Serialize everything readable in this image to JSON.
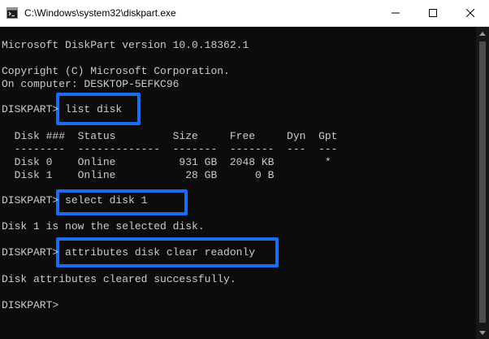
{
  "window": {
    "title": "C:\\Windows\\system32\\diskpart.exe",
    "icon": "console-icon",
    "controls": [
      "minimize-icon",
      "maximize-icon",
      "close-icon"
    ]
  },
  "colors": {
    "console_bg": "#0c0c0c",
    "console_text": "#cccccc",
    "highlight_box": "#1a6cf0",
    "titlebar_bg": "#ffffff"
  },
  "console": {
    "lines": [
      "Microsoft DiskPart version 10.0.18362.1",
      "Copyright (C) Microsoft Corporation.",
      "On computer: DESKTOP-5EFKC96",
      "DISKPART> list disk",
      "  Disk ###  Status         Size     Free     Dyn  Gpt",
      "  --------  -------------  -------  -------  ---  ---",
      "  Disk 0    Online          931 GB  2048 KB        *",
      "  Disk 1    Online           28 GB      0 B",
      "DISKPART> select disk 1",
      "Disk 1 is now the selected disk.",
      "DISKPART> attributes disk clear readonly",
      "Disk attributes cleared successfully.",
      "DISKPART>"
    ],
    "highlighted_commands": [
      "list disk",
      "select disk 1",
      "attributes disk clear readonly"
    ]
  }
}
